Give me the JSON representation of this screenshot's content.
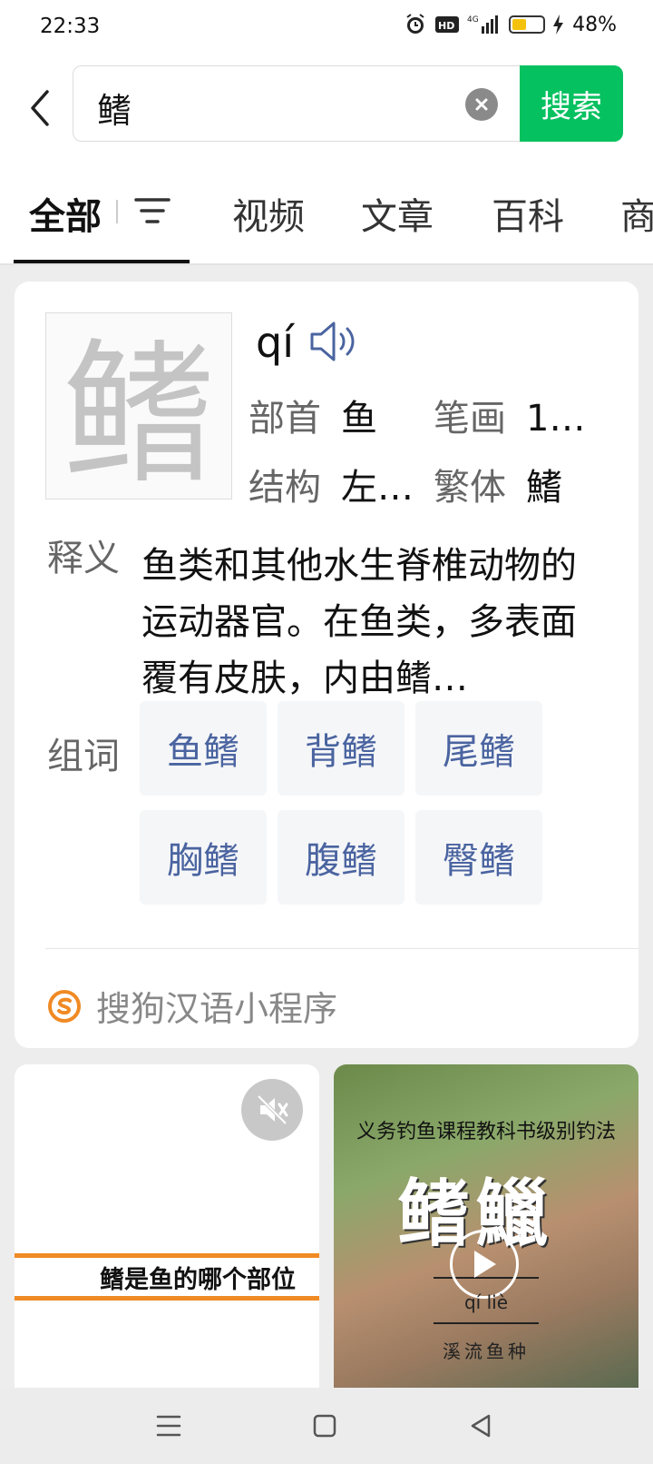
{
  "status_bar": {
    "time": "22:33",
    "battery": "48%",
    "battery_level": 0.48,
    "network": "4G"
  },
  "search": {
    "query": "鳍",
    "button_label": "搜索"
  },
  "tabs": [
    {
      "label": "全部"
    },
    {
      "label": "视频"
    },
    {
      "label": "文章"
    },
    {
      "label": "百科"
    },
    {
      "label": "商"
    }
  ],
  "dict": {
    "character": "鳍",
    "pinyin": "qí",
    "radical_label": "部首",
    "radical": "鱼",
    "strokes_label": "笔画",
    "strokes": "1…",
    "structure_label": "结构",
    "structure": "左…",
    "traditional_label": "繁体",
    "traditional": "鰭",
    "definition_label": "释义",
    "definition": "鱼类和其他水生脊椎动物的运动器官。在鱼类，多表面覆有皮肤，内由鳍…",
    "words_label": "组词",
    "words": [
      "鱼鳍",
      "背鳍",
      "尾鳍",
      "胸鳍",
      "腹鳍",
      "臀鳍"
    ],
    "source": "搜狗汉语小程序"
  },
  "videos": [
    {
      "title": "鳍是鱼的哪个部位"
    },
    {
      "top_text": "义务钓鱼课程教科书级别钓法",
      "big_text": "鳍鱲",
      "pinyin": "qí liè",
      "subtitle": "溪流鱼种"
    }
  ],
  "colors": {
    "accent": "#06c160",
    "link": "#4a64a0",
    "orange": "#f08a24"
  }
}
